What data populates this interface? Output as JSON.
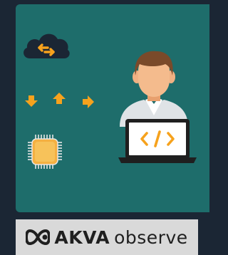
{
  "colors": {
    "page_background": "#1b2634",
    "card_background": "#1e6d6b",
    "badge_background": "#d9d9d9",
    "arrow_orange": "#f6a21d",
    "laptop_code_orange": "#f6a21d",
    "cloud": "#1b2634",
    "chip_gold": "#f5b041"
  },
  "icons": [
    "cloud-sync-icon",
    "arrow-down-icon",
    "arrow-up-icon",
    "arrow-right-icon",
    "processor-chip-icon",
    "developer-icon",
    "laptop-code-icon"
  ],
  "logo": {
    "brand": "AKVA",
    "product": "observe"
  }
}
